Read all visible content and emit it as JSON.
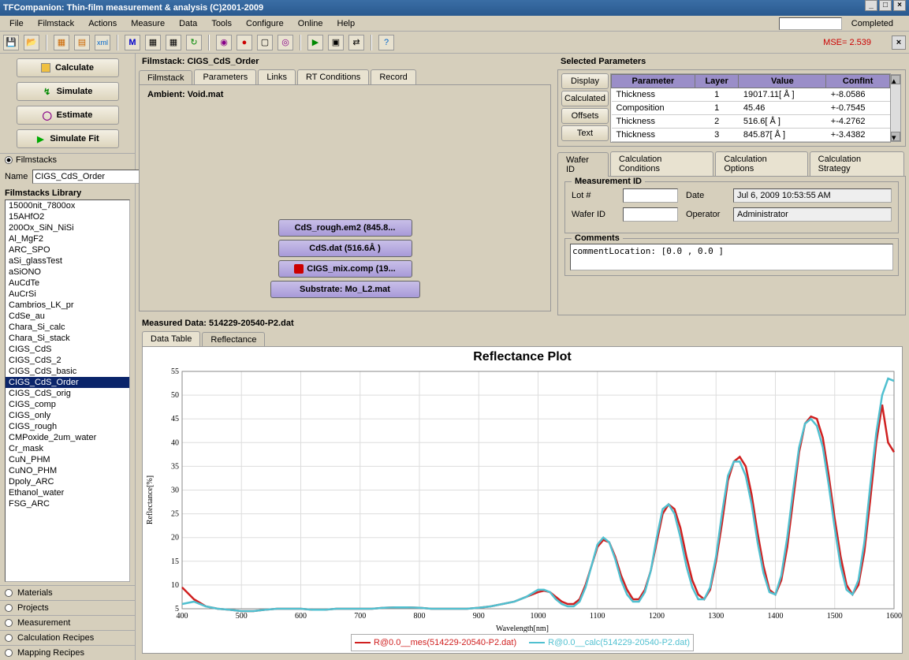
{
  "title": "TFCompanion: Thin-film measurement & analysis (C)2001-2009",
  "menu": [
    "File",
    "Filmstack",
    "Actions",
    "Measure",
    "Data",
    "Tools",
    "Configure",
    "Online",
    "Help"
  ],
  "status_completed": "Completed",
  "mse": "MSE= 2.539",
  "actions": {
    "calculate": "Calculate",
    "simulate": "Simulate",
    "estimate": "Estimate",
    "simulate_fit": "Simulate Fit"
  },
  "sidebar": {
    "radio_filmstacks": "Filmstacks",
    "name_label": "Name",
    "name_value": "CIGS_CdS_Order",
    "library_label": "Filmstacks Library",
    "items": [
      "15000nit_7800ox",
      "15AHfO2",
      "200Ox_SiN_NiSi",
      "Al_MgF2",
      "ARC_SPO",
      "aSi_glassTest",
      "aSiONO",
      "AuCdTe",
      "AuCrSi",
      "Cambrios_LK_pr",
      "CdSe_au",
      "Chara_Si_calc",
      "Chara_Si_stack",
      "CIGS_CdS",
      "CIGS_CdS_2",
      "CIGS_CdS_basic",
      "CIGS_CdS_Order",
      "CIGS_CdS_orig",
      "CIGS_comp",
      "CIGS_only",
      "CIGS_rough",
      "CMPoxide_2um_water",
      "Cr_mask",
      "CuN_PHM",
      "CuNO_PHM",
      "Dpoly_ARC",
      "Ethanol_water",
      "FSG_ARC"
    ],
    "selected": "CIGS_CdS_Order",
    "accordion": [
      "Materials",
      "Projects",
      "Measurement",
      "Calculation Recipes",
      "Mapping Recipes"
    ]
  },
  "filmstack": {
    "title": "Filmstack: CIGS_CdS_Order",
    "tabs": [
      "Filmstack",
      "Parameters",
      "Links",
      "RT Conditions",
      "Record"
    ],
    "ambient": "Ambient: Void.mat",
    "layers": [
      "CdS_rough.em2 (845.8...",
      "CdS.dat (516.6Å )",
      "CIGS_mix.comp (19...",
      "Substrate: Mo_L2.mat"
    ]
  },
  "selparams": {
    "title": "Selected Parameters",
    "btns": [
      "Display",
      "Calculated",
      "Offsets",
      "Text"
    ],
    "headers": [
      "Parameter",
      "Layer",
      "Value",
      "ConfInt"
    ],
    "rows": [
      [
        "Thickness",
        "1",
        "19017.11[ Å ]",
        "+-8.0586"
      ],
      [
        "Composition",
        "1",
        "45.46",
        "+-0.7545"
      ],
      [
        "Thickness",
        "2",
        "516.6[ Å ]",
        "+-4.2762"
      ],
      [
        "Thickness",
        "3",
        "845.87[ Å ]",
        "+-3.4382"
      ]
    ],
    "subtabs": [
      "Wafer ID",
      "Calculation Conditions",
      "Calculation Options",
      "Calculation Strategy"
    ],
    "meas_id_label": "Measurement ID",
    "lot_label": "Lot #",
    "date_label": "Date",
    "date_value": "Jul 6, 2009 10:53:55 AM",
    "wafer_label": "Wafer ID",
    "operator_label": "Operator",
    "operator_value": "Administrator",
    "comments_label": "Comments",
    "comments_value": "commentLocation: [0.0 , 0.0 ]"
  },
  "measured": {
    "title": "Measured Data: 514229-20540-P2.dat",
    "tabs": [
      "Data Table",
      "Reflectance"
    ]
  },
  "chart_data": {
    "type": "line",
    "title": "Reflectance Plot",
    "xlabel": "Wavelength[nm]",
    "ylabel": "Reflectance[%]",
    "xlim": [
      400,
      1600
    ],
    "ylim": [
      5,
      55
    ],
    "series": [
      {
        "name": "R@0.0__mes(514229-20540-P2.dat)",
        "color": "#d02020",
        "x": [
          400,
          420,
          440,
          460,
          480,
          500,
          520,
          540,
          560,
          580,
          600,
          620,
          640,
          660,
          680,
          700,
          720,
          740,
          760,
          780,
          800,
          820,
          840,
          860,
          880,
          900,
          920,
          940,
          960,
          980,
          1000,
          1010,
          1020,
          1030,
          1040,
          1050,
          1060,
          1070,
          1080,
          1090,
          1100,
          1110,
          1120,
          1130,
          1140,
          1150,
          1160,
          1170,
          1180,
          1190,
          1200,
          1210,
          1220,
          1230,
          1240,
          1250,
          1260,
          1270,
          1280,
          1290,
          1300,
          1310,
          1320,
          1330,
          1340,
          1350,
          1360,
          1370,
          1380,
          1390,
          1400,
          1410,
          1420,
          1430,
          1440,
          1450,
          1460,
          1470,
          1480,
          1490,
          1500,
          1510,
          1520,
          1530,
          1540,
          1550,
          1560,
          1570,
          1580,
          1590,
          1600
        ],
        "y": [
          9.5,
          7,
          5.5,
          5,
          4.8,
          4.5,
          4.5,
          4.8,
          5,
          5,
          5,
          4.8,
          4.8,
          5,
          5,
          5,
          5,
          5.2,
          5.3,
          5.3,
          5.2,
          5,
          5,
          5,
          5,
          5.2,
          5.5,
          6,
          6.5,
          7.5,
          8.5,
          8.8,
          8.5,
          7.5,
          6.5,
          6,
          6,
          7,
          10,
          14,
          18,
          19.5,
          19,
          16,
          12,
          9,
          7,
          7,
          9,
          13,
          19,
          25,
          27,
          26,
          22,
          16,
          11,
          8,
          7,
          9,
          15,
          23,
          32,
          36,
          37,
          35,
          29,
          21,
          14,
          9,
          8,
          11,
          18,
          28,
          38,
          44,
          45.5,
          45,
          41,
          33,
          24,
          16,
          10,
          8,
          10,
          17,
          28,
          40,
          48,
          40,
          38
        ]
      },
      {
        "name": "R@0.0__calc(514229-20540-P2.dat)",
        "color": "#50c0d0",
        "x": [
          400,
          420,
          440,
          460,
          480,
          500,
          520,
          540,
          560,
          580,
          600,
          620,
          640,
          660,
          680,
          700,
          720,
          740,
          760,
          780,
          800,
          820,
          840,
          860,
          880,
          900,
          920,
          940,
          960,
          980,
          1000,
          1010,
          1020,
          1030,
          1040,
          1050,
          1060,
          1070,
          1080,
          1090,
          1100,
          1110,
          1120,
          1130,
          1140,
          1150,
          1160,
          1170,
          1180,
          1190,
          1200,
          1210,
          1220,
          1230,
          1240,
          1250,
          1260,
          1270,
          1280,
          1290,
          1300,
          1310,
          1320,
          1330,
          1340,
          1350,
          1360,
          1370,
          1380,
          1390,
          1400,
          1410,
          1420,
          1430,
          1440,
          1450,
          1460,
          1470,
          1480,
          1490,
          1500,
          1510,
          1520,
          1530,
          1540,
          1550,
          1560,
          1570,
          1580,
          1590,
          1600
        ],
        "y": [
          6,
          6.5,
          5.5,
          5,
          4.8,
          4.5,
          4.5,
          4.8,
          5,
          5,
          5,
          4.8,
          4.8,
          5,
          5,
          5,
          5,
          5.2,
          5.3,
          5.3,
          5.2,
          5,
          5,
          5,
          5,
          5.2,
          5.5,
          6,
          6.5,
          7.5,
          9,
          9,
          8.5,
          7,
          6,
          5.5,
          5.5,
          6.5,
          9.5,
          14,
          18.5,
          20,
          19,
          15.5,
          11,
          8,
          6.5,
          6.5,
          8.5,
          13,
          20,
          26,
          27,
          25,
          20,
          14,
          9.5,
          7,
          7,
          9.5,
          16,
          25,
          33,
          36,
          36,
          33,
          27,
          19,
          12.5,
          8.5,
          8,
          12,
          20,
          30,
          39,
          44,
          45,
          43.5,
          39,
          31,
          22,
          14,
          9,
          8,
          11,
          19,
          31,
          42,
          50,
          53.5,
          53
        ]
      }
    ]
  }
}
